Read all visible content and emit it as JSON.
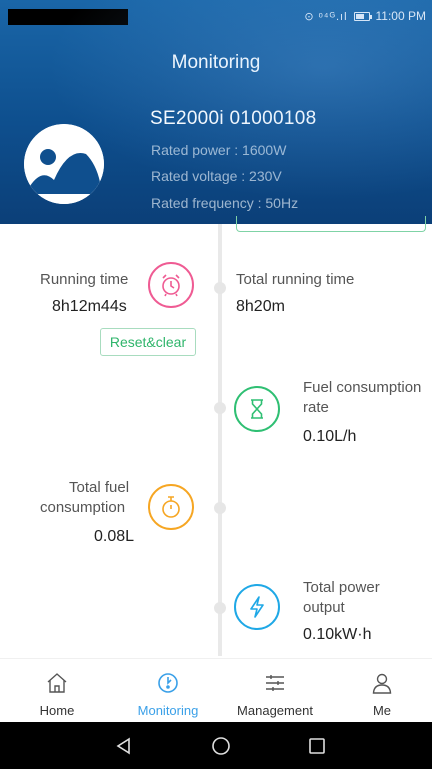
{
  "status_bar": {
    "network_glyph": "⊙ ᵒ⁴ᴳ.ıl",
    "time": "11:00 PM"
  },
  "header": {
    "title": "Monitoring",
    "device_name": "SE2000i  01000108",
    "rated_power": "Rated power : 1600W",
    "rated_voltage": "Rated voltage : 230V",
    "rated_frequency": "Rated frequency : 50Hz"
  },
  "metrics": {
    "running_time": {
      "label": "Running time",
      "value": "8h12m44s",
      "icon": "alarm-clock-icon",
      "color": "#ef5b93"
    },
    "reset_label": "Reset&clear",
    "total_running_time": {
      "label": "Total running time",
      "value": "8h20m"
    },
    "fuel_rate": {
      "label_line1": "Fuel consumption",
      "label_line2": "rate",
      "value": "0.10L/h",
      "icon": "hourglass-icon",
      "color": "#2fbf73"
    },
    "total_fuel": {
      "label_line1": "Total fuel",
      "label_line2": "consumption",
      "value": "0.08L",
      "icon": "stopwatch-icon",
      "color": "#f6a623"
    },
    "total_power": {
      "label_line1": "Total power",
      "label_line2": "output",
      "value": "0.10kW·h",
      "icon": "lightning-icon",
      "color": "#1fa8e6"
    }
  },
  "bottom_nav": {
    "items": [
      {
        "label": "Home",
        "icon": "home-icon"
      },
      {
        "label": "Monitoring",
        "icon": "monitoring-icon",
        "active": true
      },
      {
        "label": "Management",
        "icon": "sliders-icon"
      },
      {
        "label": "Me",
        "icon": "person-icon"
      }
    ],
    "active_color": "#3aa0e8"
  },
  "system_nav": [
    "back-icon",
    "home-circle-icon",
    "recents-icon"
  ]
}
